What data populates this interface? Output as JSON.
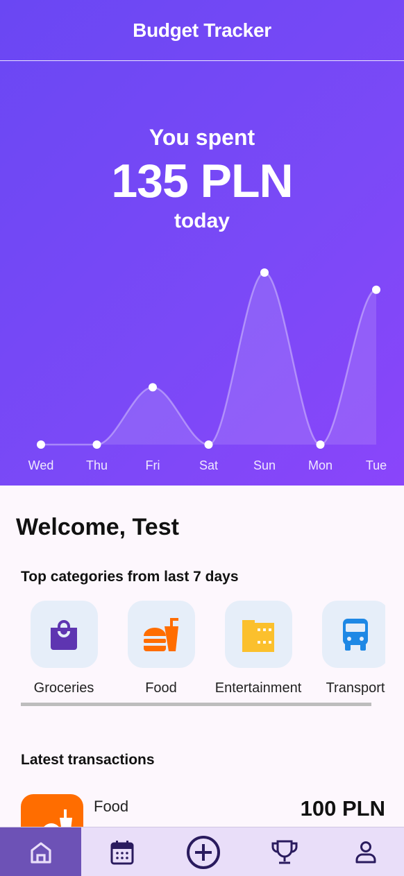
{
  "app": {
    "title": "Budget Tracker"
  },
  "summary": {
    "line1": "You spent",
    "amount": "135 PLN",
    "line3": "today"
  },
  "chart_data": {
    "type": "area",
    "categories": [
      "Wed",
      "Thu",
      "Fri",
      "Sat",
      "Sun",
      "Mon",
      "Tue"
    ],
    "values": [
      0,
      0,
      40,
      0,
      120,
      0,
      108
    ],
    "ylim": [
      0,
      120
    ],
    "grid": false
  },
  "welcome": "Welcome, Test",
  "categories": {
    "title": "Top categories from last 7 days",
    "items": [
      {
        "label": "Groceries",
        "icon": "shopping-bag-icon",
        "color": "#5e35b1"
      },
      {
        "label": "Food",
        "icon": "fastfood-icon",
        "color": "#ff6d00"
      },
      {
        "label": "Entertainment",
        "icon": "movie-film-icon",
        "color": "#fbc02d"
      },
      {
        "label": "Transport",
        "icon": "bus-icon",
        "color": "#1e88e5"
      }
    ]
  },
  "transactions": {
    "title": "Latest transactions",
    "items": [
      {
        "name": "Food",
        "amount": "100 PLN",
        "icon": "fastfood-icon",
        "color": "#ff6d00"
      }
    ]
  },
  "nav": {
    "items": [
      {
        "name": "home",
        "icon": "home-icon",
        "active": true
      },
      {
        "name": "calendar",
        "icon": "calendar-icon",
        "active": false
      },
      {
        "name": "add",
        "icon": "add-circle-icon",
        "active": false
      },
      {
        "name": "achievements",
        "icon": "trophy-icon",
        "active": false
      },
      {
        "name": "profile",
        "icon": "person-icon",
        "active": false
      }
    ]
  },
  "colors": {
    "accent": "#6a47f3",
    "nav_active": "#6d52b6",
    "nav_bg": "#e9def9",
    "icon_dark": "#2a1b5e"
  }
}
